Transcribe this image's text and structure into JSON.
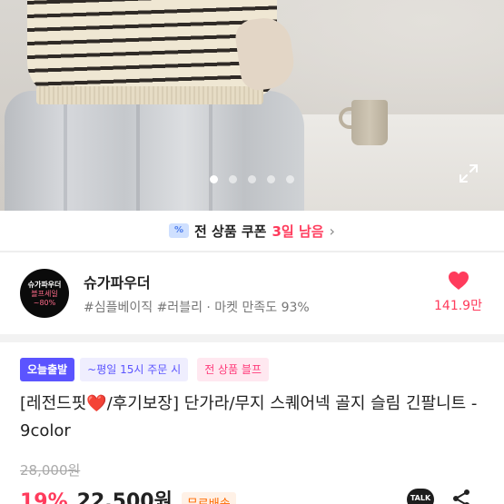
{
  "gallery": {
    "photo": "product-photo-striped-sweater-grey-skirt",
    "slide_count": 5,
    "active_slide": 1
  },
  "coupon": {
    "icon": "coupon-icon",
    "text": "전 상품 쿠폰",
    "highlight": "3일 남음",
    "chevron": "›"
  },
  "shop": {
    "logo_line1": "슈가파우더",
    "logo_line2": "블프세일",
    "logo_line3": "~80%",
    "name": "슈가파우더",
    "tags": "#심플베이직 #러블리 · 마켓 만족도 93%",
    "like_count": "141.9만"
  },
  "badges": {
    "today": "오늘출발",
    "time": "~평일 15시 주문 시",
    "sale": "전 상품 블프"
  },
  "product": {
    "title_part1": "[레전드핏",
    "title_heart": "❤️",
    "title_part2": "/후기보장] 단가라/무지 스퀘어넥 골지 슬림 긴팔니트 - 9color",
    "original_price": "28,000원",
    "discount": "19%",
    "price": "22,500원",
    "shipping": "무료배송",
    "talk_label": "TALK"
  },
  "colors": {
    "accent": "#ff3b5c",
    "badge_primary": "#5b54ff"
  }
}
